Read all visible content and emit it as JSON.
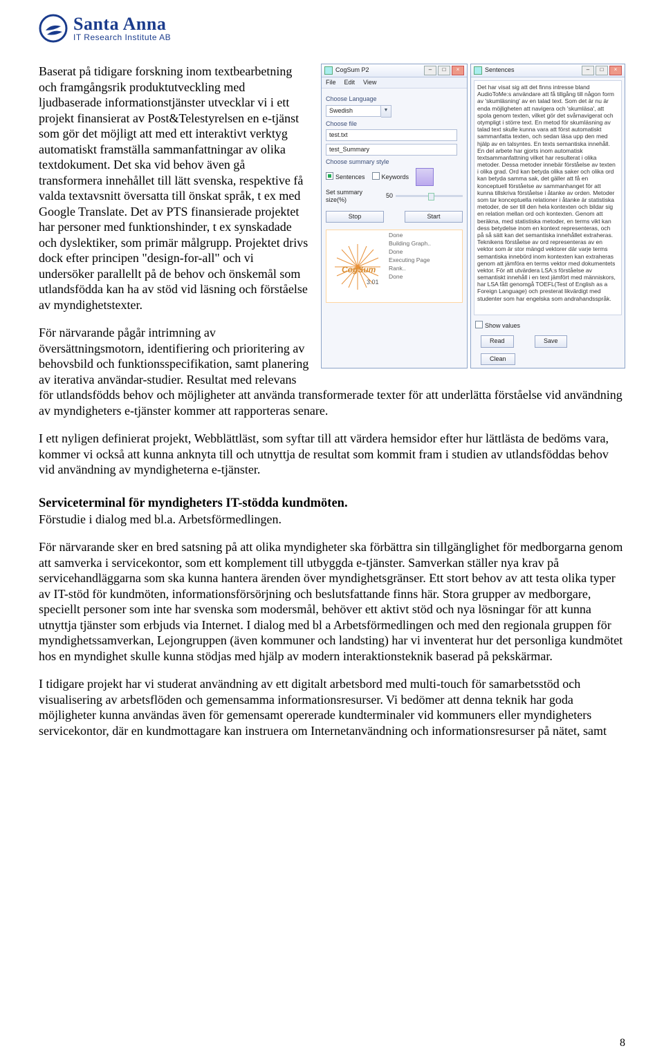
{
  "logo": {
    "line1": "Santa Anna",
    "line2": "IT Research Institute AB"
  },
  "paragraphs": {
    "p1_full": "Baserat på tidigare forskning inom textbearbetning och framgångsrik produktutveckling med ljudbaserade informationstjänster utvecklar vi i ett projekt finansierat av Post&Telestyrelsen en e-tjänst som gör det möjligt att med ett interaktivt verktyg automatiskt framställa sammanfattningar av olika textdokument. Det ska vid behov även gå transformera innehållet till lätt svenska, respektive få valda textavsnitt översatta till önskat språk, t ex med Google Translate. Det av PTS finansierade projektet har personer med funktionshinder, t ex synskadade och dyslektiker, som primär målgrupp. Projektet drivs dock efter principen \"design-for-all\" och vi undersöker parallellt på de behov och önskemål som utlandsfödda kan ha av stöd vid läsning och förståelse av myndighetstexter.",
    "p2": "För närvarande pågår intrimning av översättningsmotorn, identifiering och prioritering av behovsbild och funktionsspecifikation, samt planering av iterativa användar-studier. Resultat med relevans för utlandsfödds behov och möjligheter att använda transformerade texter för att underlätta förståelse vid användning av myndigheters e-tjänster kommer att rapporteras senare.",
    "p3": "I ett nyligen definierat projekt, Webblättläst, som syftar till att värdera hemsidor efter hur lättlästa de bedöms vara, kommer vi också att kunna anknyta till och utnyttja de resultat som kommit fram i studien av utlandsföddas behov vid användning av myndigheterna e-tjänster.",
    "p4": "För närvarande sker en bred satsning på att olika myndigheter ska förbättra sin tillgänglighet för medborgarna genom att samverka i servicekontor, som ett komplement till utbyggda e-tjänster. Samverkan ställer nya krav på servicehandläggarna som ska kunna hantera ärenden över myndighetsgränser. Ett stort behov av att testa olika typer av IT-stöd för kundmöten, informationsförsörjning och beslutsfattande finns här. Stora grupper av medborgare, speciellt personer som inte har svenska som modersmål, behöver ett aktivt stöd och nya lösningar för att kunna utnyttja tjänster som erbjuds via Internet. I dialog med bl a Arbetsförmedlingen och med den regionala gruppen för myndighetssamverkan, Lejongruppen (även kommuner och landsting) har vi inventerat hur det personliga kundmötet hos en myndighet skulle kunna stödjas med hjälp av modern interaktionsteknik baserad på pekskärmar.",
    "p5": "I tidigare projekt har vi studerat användning av ett digitalt arbetsbord med multi-touch för samarbetsstöd och visualisering av arbetsflöden och gemensamma informationsresurser. Vi bedömer att denna teknik har goda möjligheter kunna användas även för gemensamt opererade kundterminaler vid kommuners eller myndigheters servicekontor, där en kundmottagare kan instruera om Internetanvändning och informationsresurser på nätet, samt"
  },
  "section": {
    "title": "Serviceterminal för myndigheters IT-stödda kundmöten.",
    "subtitle": "Förstudie i dialog med bl.a. Arbetsförmedlingen."
  },
  "page_number": "8",
  "app_left": {
    "title": "CogSum P2",
    "menu": [
      "File",
      "Edit",
      "View"
    ],
    "choose_language_label": "Choose Language",
    "language_value": "Swedish",
    "choose_file_label": "Choose file",
    "file1": "test.txt",
    "file2": "test_Summary",
    "summary_style_label": "Choose summary style",
    "opt_sentences": "Sentences",
    "opt_keywords": "Keywords",
    "slider_label": "Set summary size(%)",
    "slider_value": "50",
    "btn_stop": "Stop",
    "btn_start": "Start",
    "cogsum_brand": "CogSum",
    "version": "3.01",
    "status": [
      "Done",
      "Building Graph..",
      "Done",
      "Executing Page",
      "Rank..",
      "Done"
    ]
  },
  "app_right": {
    "title": "Sentences",
    "body": "Det har visat sig att det finns intresse bland AudioToMe:s användare att få tillgång till någon form av 'skumläsning' av en talad text. Som det är nu är enda möjligheten att navigera och 'skumläsa', att spola genom texten, vilket gör det svårnavigerat och otympligt i större text. En metod för skumläsning av talad text skulle kunna vara att först automatiskt sammanfatta texten, och sedan läsa upp den med hjälp av en talsyntes. En texts semantiska innehåll. En del arbete har gjorts inom automatisk textsammanfattning vilket har resulterat i olika metoder. Dessa metoder innebär förståelse av texten i olika grad. Ord kan betyda olika saker och olika ord kan betyda samma sak, det gäller att få en konceptuell förståelse av sammanhanget för att kunna tillskriva förståelse i åtanke av orden. Metoder som tar konceptuella relationer i åtanke är statistiska metoder, de ser till den hela kontexten och bildar sig en relation mellan ord och kontexten. Genom att beräkna, med statistiska metoder, en terms vikt kan dess betydelse inom en kontext representeras, och på så sätt kan det semantiska innehållet extraheras. Teknikens förståelse av ord representeras av en vektor som är stor mängd vektorer där varje terms semantiska innebörd inom kontexten kan extraheras genom att jämföra en terms vektor med dokumentets vektor. För att utvärdera LSA:s förståelse av semantiskt innehåll i en text jämfört med människors, har LSA fått genomgå TOEFL(Test of English as a Foreign Language) och presterat likvärdigt med studenter som har engelska som andrahandsspråk.",
    "show_values": "Show values",
    "btn_read": "Read",
    "btn_save": "Save",
    "btn_clean": "Clean"
  }
}
